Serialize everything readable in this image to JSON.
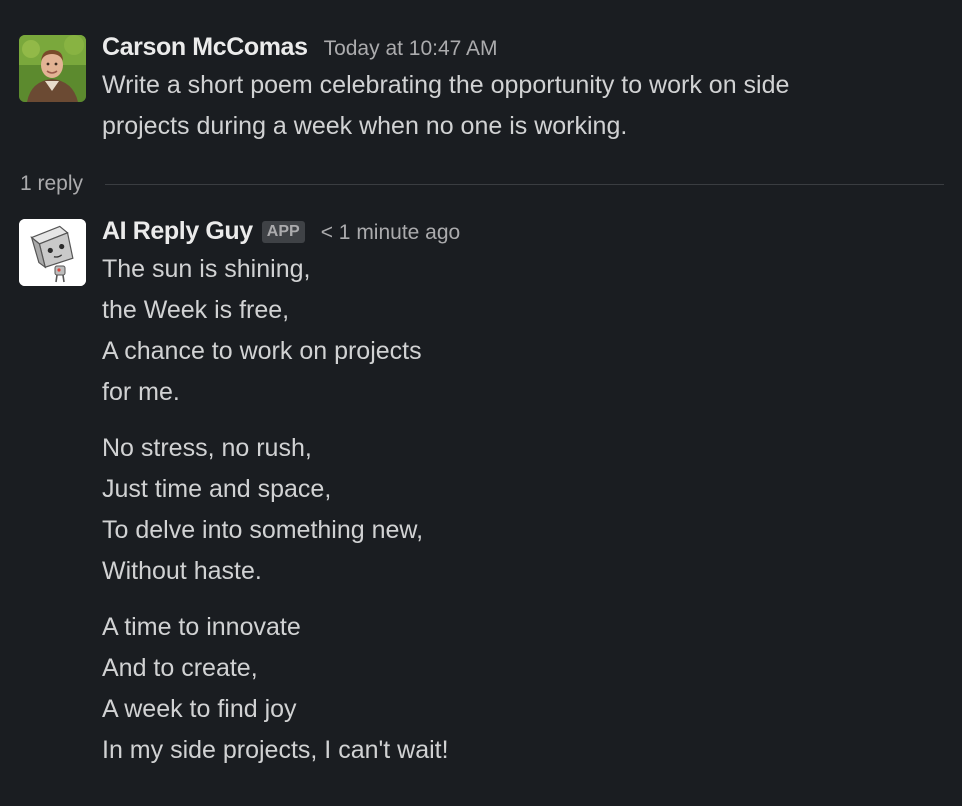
{
  "original_message": {
    "author": "Carson McComas",
    "timestamp": "Today at 10:47 AM",
    "avatar_icon": "user-photo-avatar",
    "text_lines": [
      "Write a short poem celebrating the opportunity to work on side",
      "projects during a week when no one is working."
    ]
  },
  "thread": {
    "reply_count_label": "1 reply"
  },
  "reply_message": {
    "author": "AI Reply Guy",
    "badge": "APP",
    "timestamp": "< 1 minute ago",
    "avatar_icon": "robot-avatar",
    "stanzas": [
      [
        "The sun is shining,",
        "the Week is free,",
        "A chance to work on projects",
        "for me."
      ],
      [
        "No stress, no rush,",
        "Just time and space,",
        "To delve into something new,",
        "Without haste."
      ],
      [
        "A time to innovate",
        "And to create,",
        "A week to find joy",
        "In my side projects, I can't wait!"
      ]
    ]
  },
  "colors": {
    "background": "#1a1d21",
    "text": "#d1d2d3",
    "author": "#ebebeb",
    "muted": "#ababad",
    "badge_bg": "#3f4246",
    "divider": "#3a3d41"
  }
}
